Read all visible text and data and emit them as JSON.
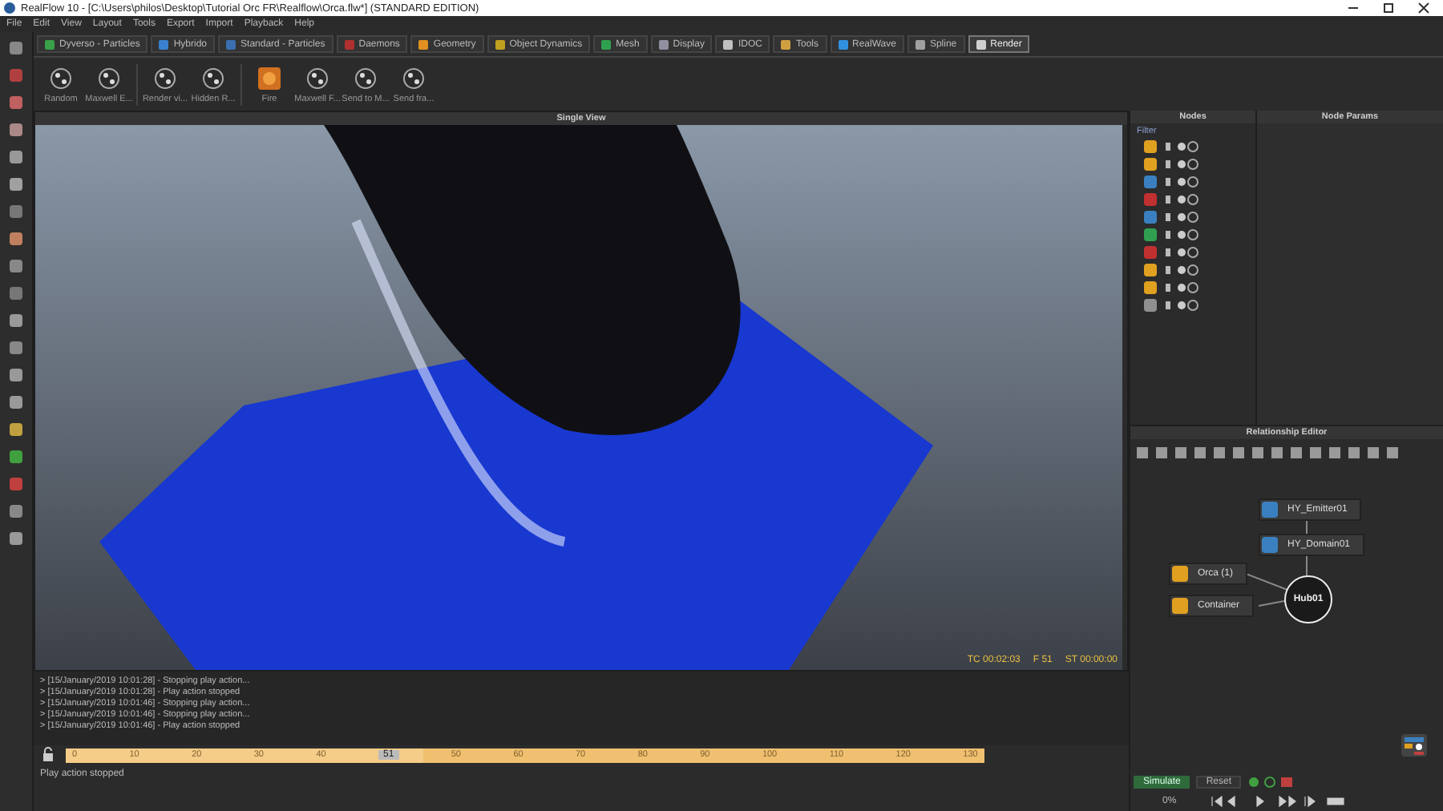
{
  "window": {
    "title": "RealFlow 10 - [C:\\Users\\philos\\Desktop\\Tutorial Orc FR\\Realflow\\Orca.flw*] (STANDARD EDITION)"
  },
  "menu": [
    "File",
    "Edit",
    "View",
    "Layout",
    "Tools",
    "Export",
    "Import",
    "Playback",
    "Help"
  ],
  "tabs": [
    {
      "label": "Dyverso - Particles",
      "selected": false,
      "color": "#3aa04a"
    },
    {
      "label": "Hybrido",
      "selected": false,
      "color": "#3a7fd0"
    },
    {
      "label": "Standard - Particles",
      "selected": false,
      "color": "#3a6fb0"
    },
    {
      "label": "Daemons",
      "selected": false,
      "color": "#b03030"
    },
    {
      "label": "Geometry",
      "selected": false,
      "color": "#e09020"
    },
    {
      "label": "Object Dynamics",
      "selected": false,
      "color": "#c0a020"
    },
    {
      "label": "Mesh",
      "selected": false,
      "color": "#30a050"
    },
    {
      "label": "Display",
      "selected": false,
      "color": "#9090a0"
    },
    {
      "label": "IDOC",
      "selected": false,
      "color": "#c0c0c0"
    },
    {
      "label": "Tools",
      "selected": false,
      "color": "#d0a040"
    },
    {
      "label": "RealWave",
      "selected": false,
      "color": "#3090e0"
    },
    {
      "label": "Spline",
      "selected": false,
      "color": "#a0a0a0"
    },
    {
      "label": "Render",
      "selected": true,
      "color": "#d0d0d0"
    }
  ],
  "shelf": [
    {
      "label": "Random",
      "kind": "plain"
    },
    {
      "label": "Maxwell E...",
      "kind": "plain"
    },
    {
      "label": "Render vi...",
      "kind": "plain"
    },
    {
      "label": "Hidden R...",
      "kind": "plain"
    },
    {
      "label": "Fire",
      "kind": "fire"
    },
    {
      "label": "Maxwell F...",
      "kind": "plain"
    },
    {
      "label": "Send to M...",
      "kind": "plain"
    },
    {
      "label": "Send fra...",
      "kind": "plain"
    }
  ],
  "viewport": {
    "title": "Single View",
    "readouts": [
      "TC 00:02:03",
      "F 51",
      "ST 00:00:00"
    ]
  },
  "nodes_panel": {
    "title": "Nodes",
    "filter": "Filter",
    "items": [
      {
        "color": "#e0a020"
      },
      {
        "color": "#e0a020"
      },
      {
        "color": "#3a80c0"
      },
      {
        "color": "#c03030"
      },
      {
        "color": "#3a80c0"
      },
      {
        "color": "#30a050"
      },
      {
        "color": "#c03030"
      },
      {
        "color": "#e0a020"
      },
      {
        "color": "#e0a020"
      },
      {
        "color": "#909090"
      }
    ]
  },
  "params_panel": {
    "title": "Node Params"
  },
  "relationship_editor": {
    "title": "Relationship Editor",
    "nodes": [
      {
        "label": "HY_Emitter01",
        "color": "#3a80c0"
      },
      {
        "label": "HY_Domain01",
        "color": "#3a80c0"
      },
      {
        "label": "Orca (1)",
        "color": "#e0a020"
      },
      {
        "label": "Container",
        "color": "#e0a020"
      }
    ],
    "hub": "Hub01"
  },
  "console": [
    "> [15/January/2019 10:01:28] - Stopping play action...",
    "> [15/January/2019 10:01:28] - Play action stopped",
    "> [15/January/2019 10:01:46] - Stopping play action...",
    "> [15/January/2019 10:01:46] - Stopping play action...",
    "> [15/January/2019 10:01:46] - Play action stopped"
  ],
  "timeline": {
    "ticks": [
      "0",
      "10",
      "20",
      "30",
      "40",
      "50",
      "60",
      "70",
      "80",
      "90",
      "100",
      "110",
      "120",
      "130"
    ],
    "current": "51",
    "level": 0.39
  },
  "controls": {
    "simulate": "Simulate",
    "reset": "Reset",
    "progress": "0%"
  },
  "status_bar": "Play action stopped"
}
